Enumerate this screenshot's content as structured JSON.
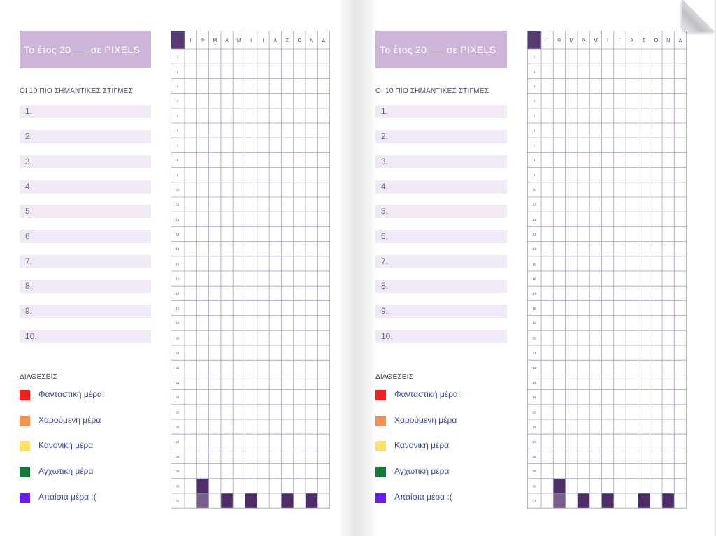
{
  "title": "Το έτος 20___ σε PIXELS",
  "moments_heading": "ΟΙ 10 ΠΙΟ ΣΗΜΑΝΤΙΚΕΣ ΣΤΙΓΜΕΣ",
  "moments": [
    "1.",
    "2.",
    "3.",
    "4.",
    "5.",
    "6.",
    "7.",
    "8.",
    "9.",
    "10."
  ],
  "moods_heading": "ΔΙΑΘΕΣΕΙΣ",
  "moods": [
    {
      "label": "Φανταστική μέρα!",
      "color": "#f02020"
    },
    {
      "label": "Χαρούμενη μέρα",
      "color": "#f7914d"
    },
    {
      "label": "Κανονική μέρα",
      "color": "#fde36b"
    },
    {
      "label": "Αγχωτική μέρα",
      "color": "#177a3a"
    },
    {
      "label": "Απαίσια μέρα :(",
      "color": "#6a1ff0"
    }
  ],
  "months": [
    "Ι",
    "Φ",
    "Μ",
    "Α",
    "Μ",
    "Ι",
    "Ι",
    "Α",
    "Σ",
    "Ο",
    "Ν",
    "Δ"
  ],
  "days": [
    "1",
    "2",
    "3",
    "4",
    "5",
    "6",
    "7",
    "8",
    "9",
    "10",
    "11",
    "12",
    "13",
    "14",
    "15",
    "16",
    "17",
    "18",
    "19",
    "20",
    "21",
    "22",
    "23",
    "24",
    "25",
    "26",
    "27",
    "28",
    "29",
    "30",
    "31"
  ],
  "colors": {
    "accent": "#5a3a73",
    "header_fill": "#cdb5d9",
    "grid_line": "#9ea3c9",
    "dark_cell": "#4f2e68",
    "faded_cell": "#5f4478"
  },
  "filled_cells": [
    {
      "day": 30,
      "month": 1,
      "shade": "dark"
    },
    {
      "day": 31,
      "month": 1,
      "shade": "faded"
    },
    {
      "day": 31,
      "month": 3,
      "shade": "dark"
    },
    {
      "day": 31,
      "month": 5,
      "shade": "dark"
    },
    {
      "day": 31,
      "month": 8,
      "shade": "dark"
    },
    {
      "day": 31,
      "month": 10,
      "shade": "dark"
    }
  ]
}
